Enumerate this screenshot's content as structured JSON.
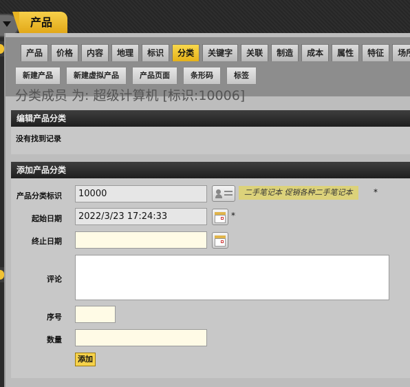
{
  "header": {
    "title": "产品"
  },
  "tabs": [
    {
      "label": "产品",
      "selected": false
    },
    {
      "label": "价格",
      "selected": false
    },
    {
      "label": "内容",
      "selected": false
    },
    {
      "label": "地理",
      "selected": false
    },
    {
      "label": "标识",
      "selected": false
    },
    {
      "label": "分类",
      "selected": true
    },
    {
      "label": "关键字",
      "selected": false
    },
    {
      "label": "关联",
      "selected": false
    },
    {
      "label": "制造",
      "selected": false
    },
    {
      "label": "成本",
      "selected": false
    },
    {
      "label": "属性",
      "selected": false
    },
    {
      "label": "特征",
      "selected": false
    },
    {
      "label": "场所",
      "selected": false
    }
  ],
  "buttons": {
    "new_product": "新建产品",
    "new_virtual_product": "新建虚拟产品",
    "product_page": "产品页面",
    "barcode": "条形码",
    "tags": "标签"
  },
  "page_title": "分类成员 为: 超级计算机 [标识:10006]",
  "edit_section": {
    "header": "编辑产品分类",
    "empty_text": "没有找到记录"
  },
  "add_section": {
    "header": "添加产品分类",
    "fields": {
      "category_id": {
        "label": "产品分类标识",
        "value": "10000",
        "hint": "二手笔记本 促销各种二手笔记本",
        "required": "*"
      },
      "from_date": {
        "label": "起始日期",
        "value": "2022/3/23 17:24:33",
        "required": "*"
      },
      "thru_date": {
        "label": "终止日期",
        "value": ""
      },
      "comments": {
        "label": "评论",
        "value": ""
      },
      "sequence": {
        "label": "序号",
        "value": ""
      },
      "quantity": {
        "label": "数量",
        "value": ""
      }
    },
    "submit_label": "添加"
  },
  "colors": {
    "accent": "#f1c232",
    "header_bg": "#2b2b2b",
    "panel_bg": "#bdbdbd"
  }
}
